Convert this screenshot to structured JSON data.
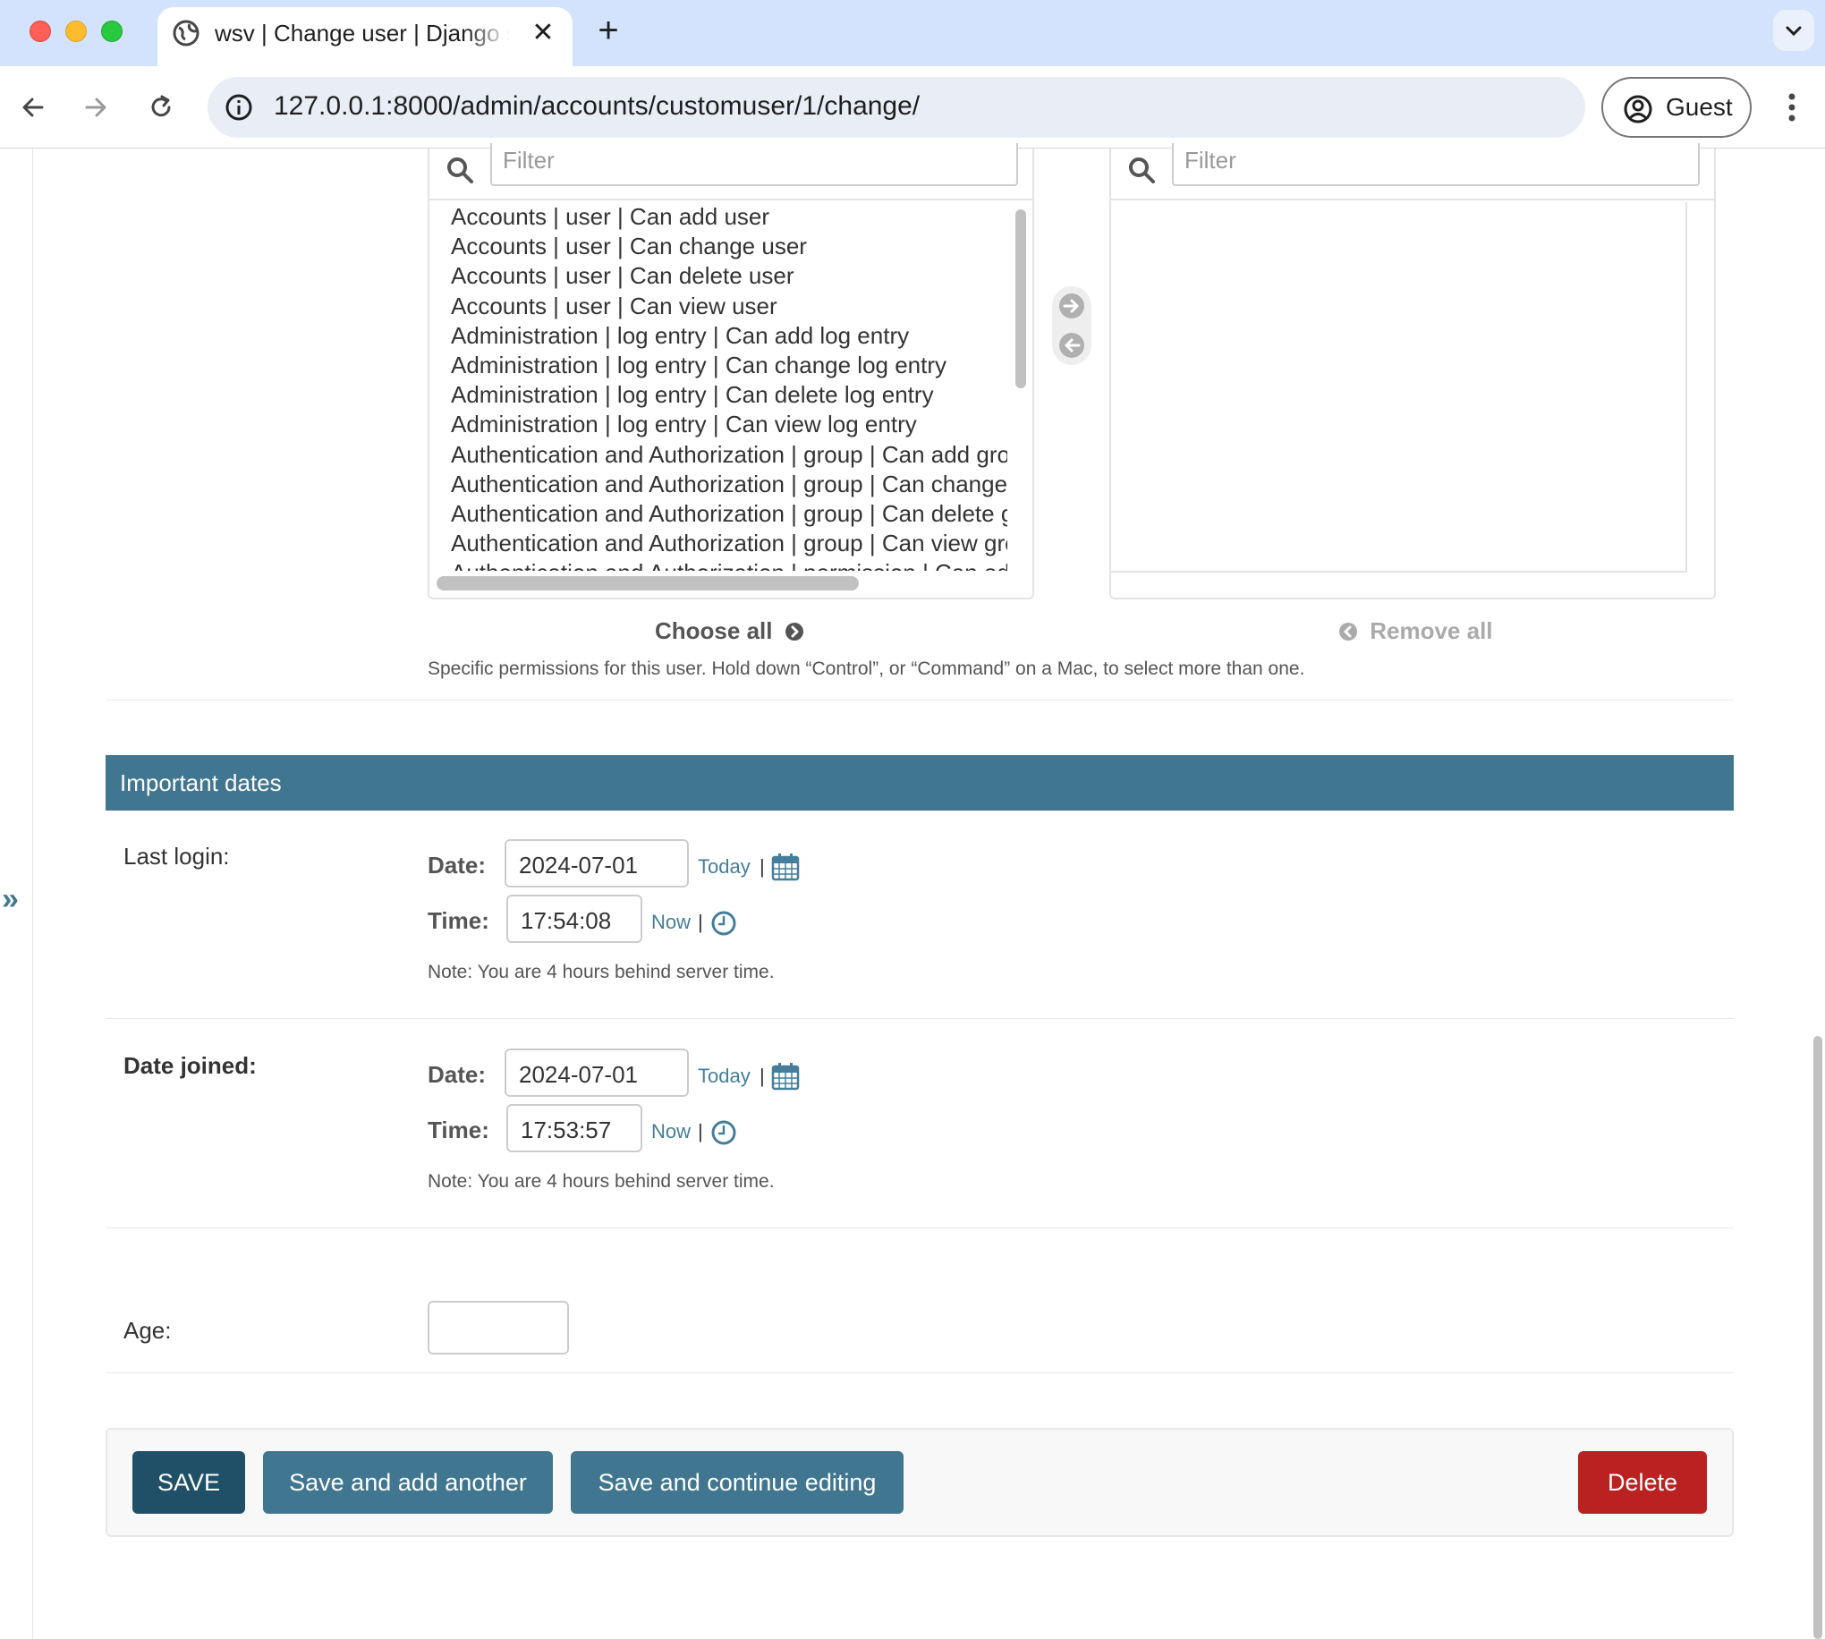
{
  "browser": {
    "tab_title": "wsv | Change user | Django site admin",
    "url": "127.0.0.1:8000/admin/accounts/customuser/1/change/",
    "profile_label": "Guest",
    "new_tab": "+",
    "close_tab": "✕"
  },
  "permissions": {
    "available_filter_placeholder": "Filter",
    "chosen_filter_placeholder": "Filter",
    "available": [
      "Accounts | user | Can add user",
      "Accounts | user | Can change user",
      "Accounts | user | Can delete user",
      "Accounts | user | Can view user",
      "Administration | log entry | Can add log entry",
      "Administration | log entry | Can change log entry",
      "Administration | log entry | Can delete log entry",
      "Administration | log entry | Can view log entry",
      "Authentication and Authorization | group | Can add group",
      "Authentication and Authorization | group | Can change group",
      "Authentication and Authorization | group | Can delete group",
      "Authentication and Authorization | group | Can view group",
      "Authentication and Authorization | permission | Can add permission"
    ],
    "choose_all": "Choose all",
    "remove_all": "Remove all",
    "help_text": "Specific permissions for this user. Hold down “Control”, or “Command” on a Mac, to select more than one."
  },
  "important_dates": {
    "header": "Important dates",
    "last_login": {
      "label": "Last login:",
      "date_label": "Date:",
      "date_value": "2024-07-01",
      "today": "Today",
      "time_label": "Time:",
      "time_value": "17:54:08",
      "now": "Now",
      "note": "Note: You are 4 hours behind server time."
    },
    "date_joined": {
      "label": "Date joined:",
      "date_label": "Date:",
      "date_value": "2024-07-01",
      "today": "Today",
      "time_label": "Time:",
      "time_value": "17:53:57",
      "now": "Now",
      "note": "Note: You are 4 hours behind server time."
    },
    "separator": "|"
  },
  "age": {
    "label": "Age:",
    "value": ""
  },
  "submit_row": {
    "save": "SAVE",
    "save_add_another": "Save and add another",
    "save_continue": "Save and continue editing",
    "delete": "Delete"
  },
  "sidebar_toggle": "»",
  "colors": {
    "module_header": "#417690",
    "save_button": "#205067",
    "secondary_button": "#417690",
    "delete_button": "#ba2121",
    "link": "#447e9b"
  },
  "icons": {
    "tab": "globe-icon",
    "filter": "search-icon",
    "add": "arrow-right-circle-icon",
    "remove": "arrow-left-circle-icon",
    "date": "calendar-icon",
    "time": "clock-icon"
  }
}
